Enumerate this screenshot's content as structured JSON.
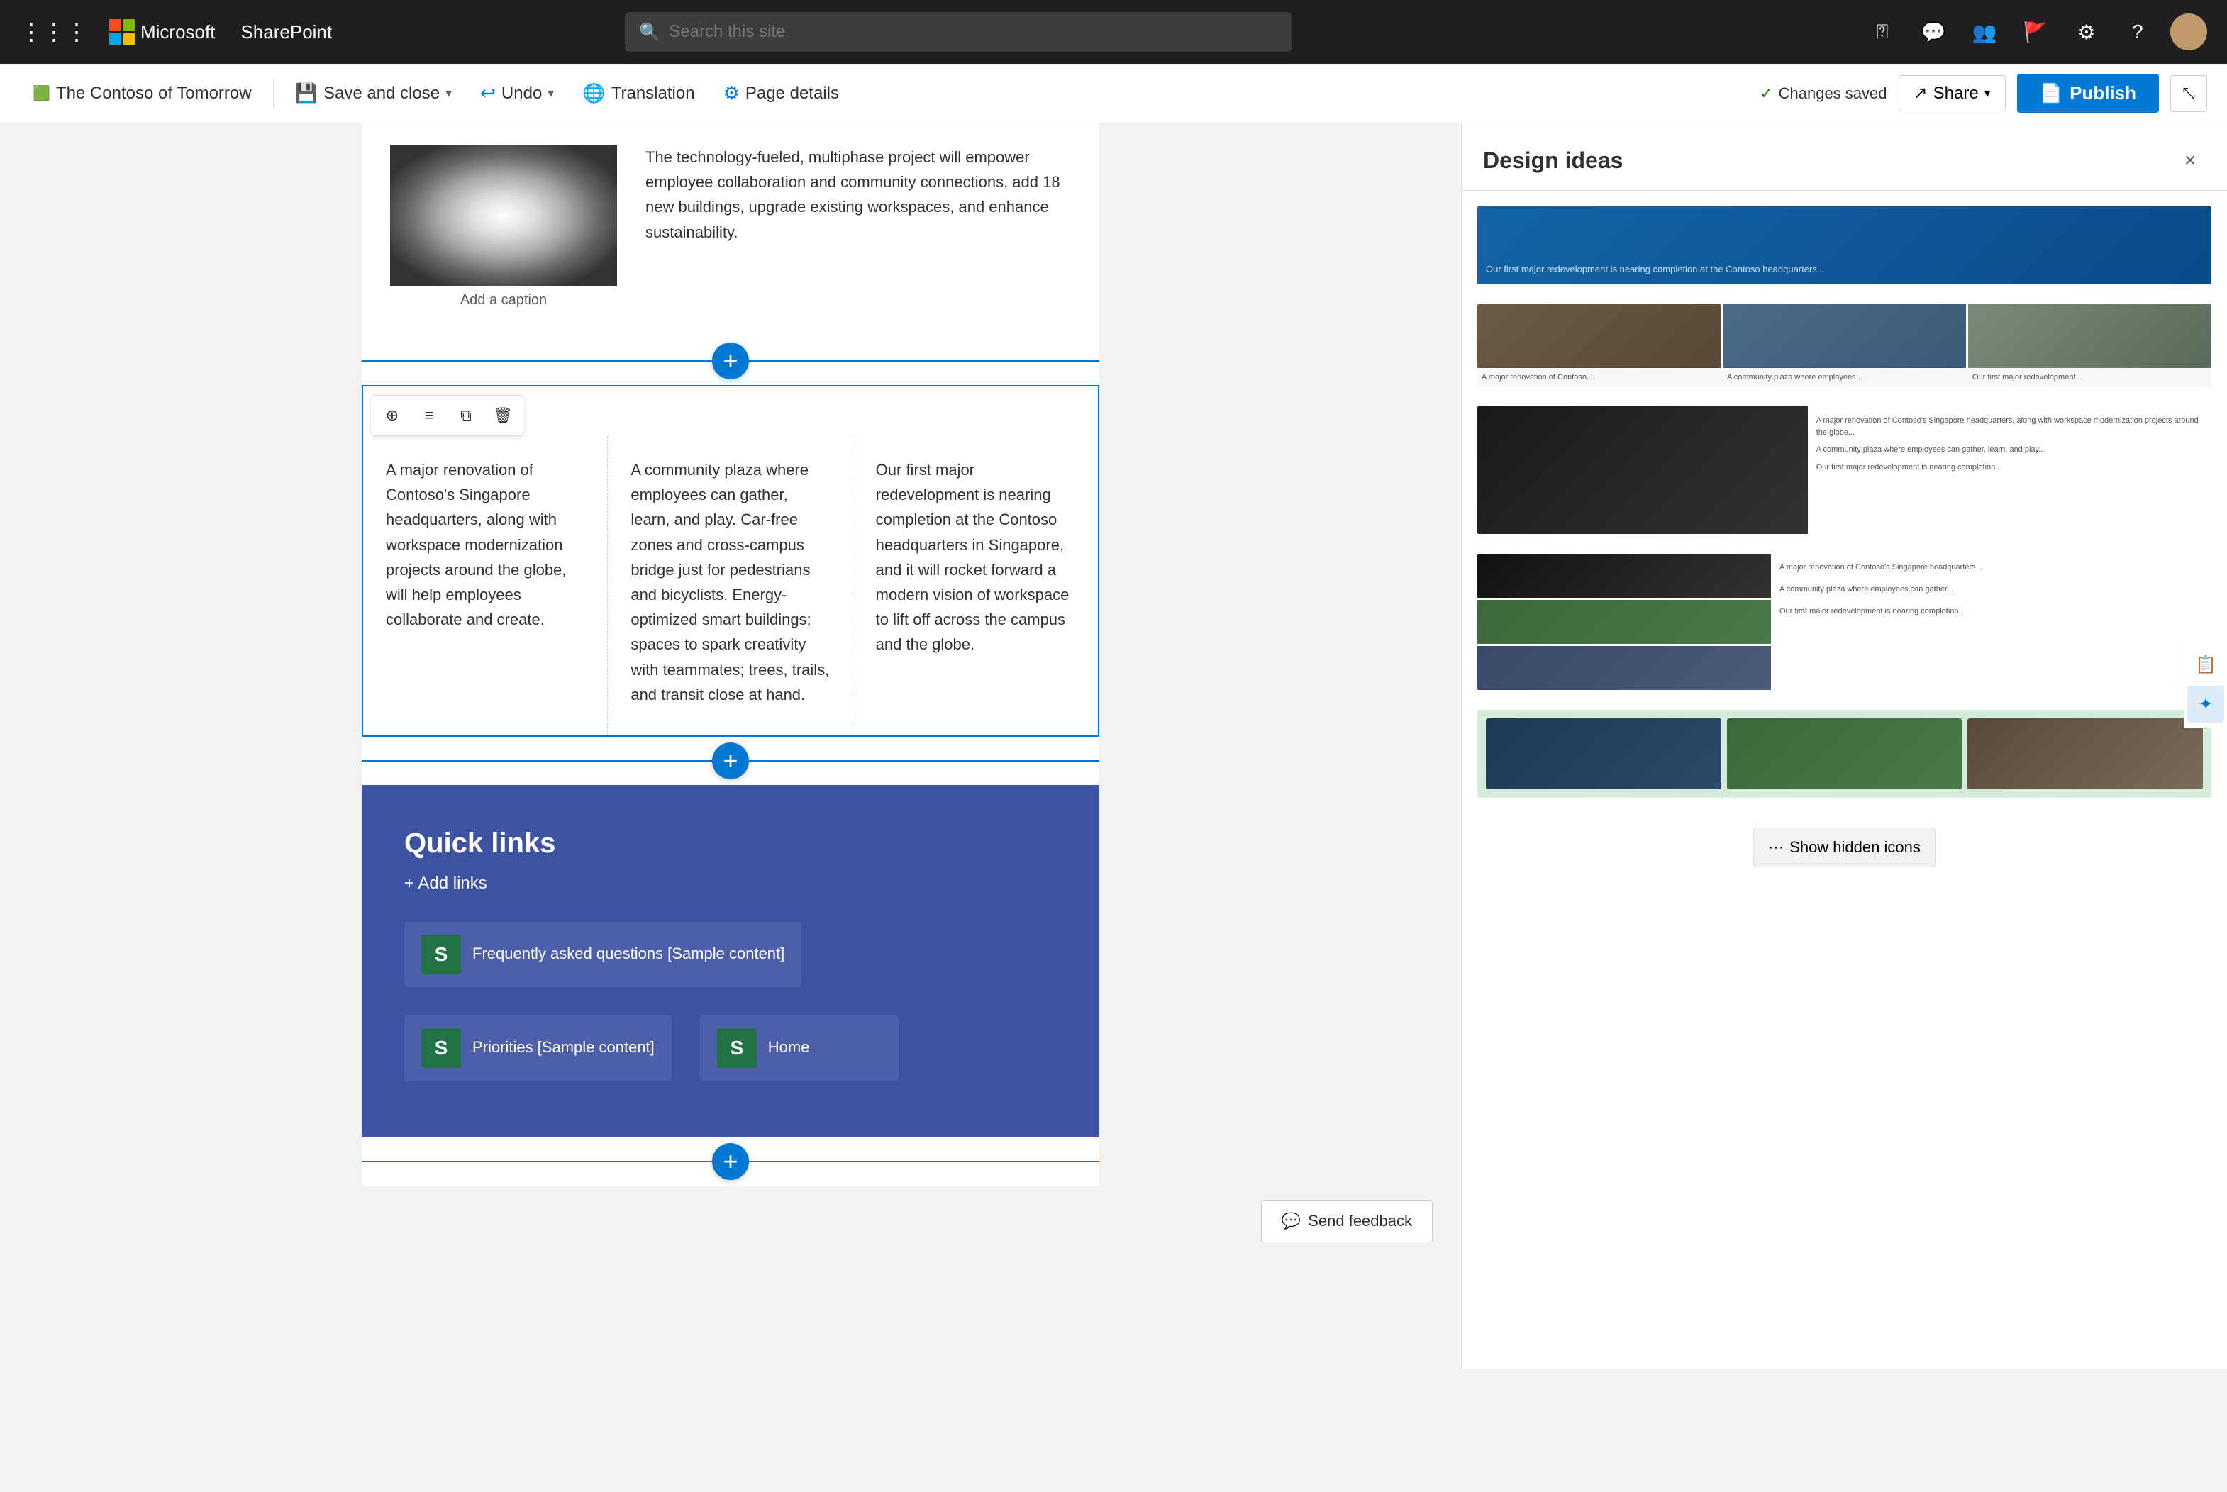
{
  "topnav": {
    "app_name": "Microsoft",
    "product_name": "SharePoint",
    "search_placeholder": "Search this site"
  },
  "toolbar": {
    "site_name": "The Contoso of Tomorrow",
    "save_close_label": "Save and close",
    "undo_label": "Undo",
    "translation_label": "Translation",
    "page_details_label": "Page details",
    "changes_saved_label": "Changes saved",
    "share_label": "Share",
    "publish_label": "Publish"
  },
  "content": {
    "body_text_1": "The technology-fueled, multiphase project will empower employee collaboration and community connections, add 18 new buildings, upgrade existing workspaces, and enhance sustainability.",
    "image_caption": "Add a caption",
    "col1_text": "A major renovation of Contoso's Singapore headquarters, along with workspace modernization projects around the globe, will help employees collaborate and create.",
    "col2_text": "A community plaza where employees can gather, learn, and play. Car-free zones and cross-campus bridge just for pedestrians and bicyclists. Energy-optimized smart buildings; spaces to spark creativity with teammates; trees, trails, and transit close at hand.",
    "col3_text": "Our first major redevelopment is nearing completion at the Contoso headquarters in Singapore, and it will rocket forward a modern vision of workspace to lift off across the campus and the globe.",
    "quick_links_title": "Quick links",
    "add_links_label": "+ Add links",
    "ql_item1_label": "Frequently asked questions [Sample content]",
    "ql_item2_label": "Priorities [Sample content]",
    "ql_item3_label": "Home"
  },
  "design_panel": {
    "title": "Design ideas",
    "close_label": "×"
  },
  "status_bar": {
    "send_feedback_label": "Send feedback",
    "show_hidden_label": "Show hidden icons"
  }
}
